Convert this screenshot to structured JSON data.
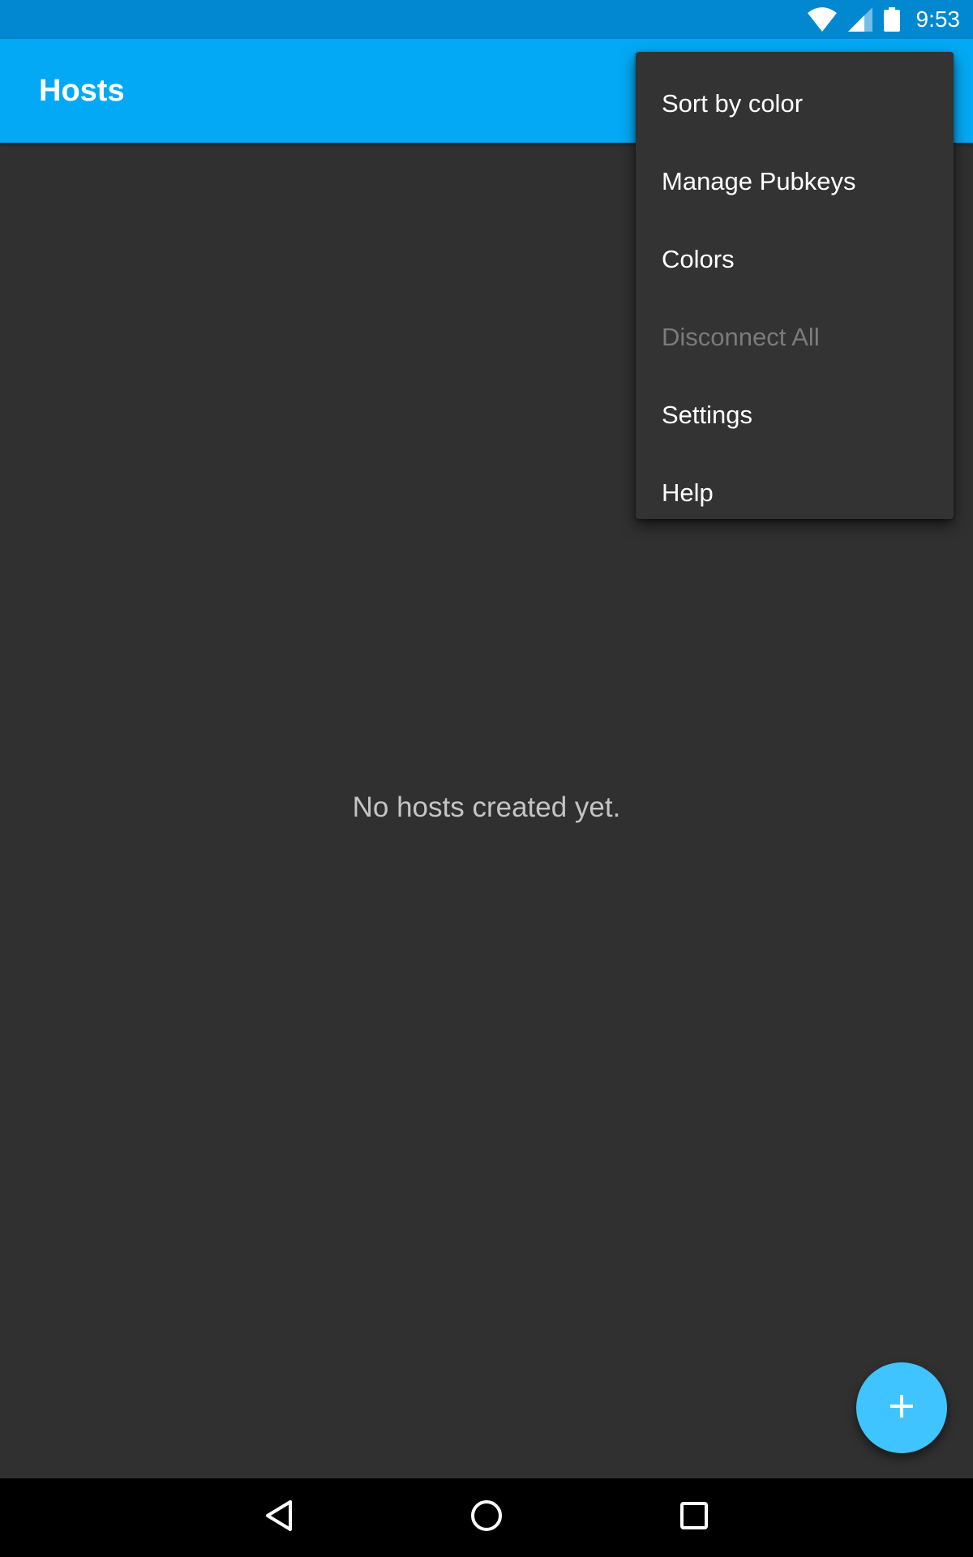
{
  "status_bar": {
    "time": "9:53",
    "icons": [
      "wifi-icon",
      "cell-signal-icon",
      "battery-icon"
    ]
  },
  "app_bar": {
    "title": "Hosts"
  },
  "main": {
    "empty_message": "No hosts created yet."
  },
  "overflow_menu": {
    "items": [
      {
        "label": "Sort by color",
        "enabled": true
      },
      {
        "label": "Manage Pubkeys",
        "enabled": true
      },
      {
        "label": "Colors",
        "enabled": true
      },
      {
        "label": "Disconnect All",
        "enabled": false
      },
      {
        "label": "Settings",
        "enabled": true
      },
      {
        "label": "Help",
        "enabled": true
      }
    ]
  },
  "fab": {
    "icon": "plus-icon"
  },
  "nav_bar": {
    "buttons": [
      "back-icon",
      "home-icon",
      "recents-icon"
    ]
  },
  "colors": {
    "status_bar": "#0288d1",
    "app_bar": "#03a9f4",
    "background": "#303030",
    "menu_background": "#333333",
    "fab": "#40c4ff",
    "disabled_text": "#7b7b7b"
  }
}
